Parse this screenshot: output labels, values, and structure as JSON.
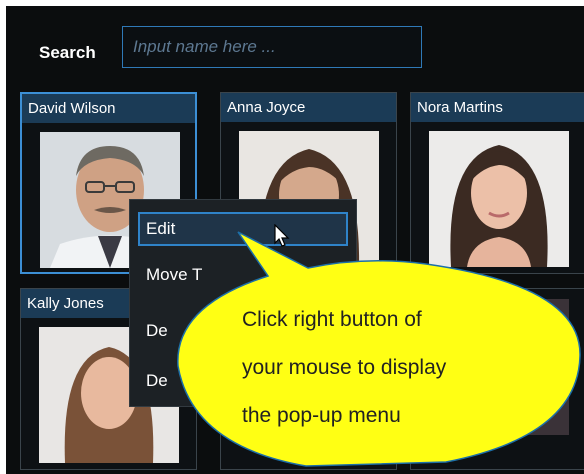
{
  "search": {
    "label": "Search",
    "placeholder": "Input name here ..."
  },
  "faces": [
    {
      "name": "David Wilson",
      "selected": true
    },
    {
      "name": "Anna Joyce",
      "selected": false
    },
    {
      "name": "Nora Martins",
      "selected": false
    },
    {
      "name": "Kally Jones",
      "selected": false
    }
  ],
  "context_menu": {
    "items": [
      {
        "label": "Edit",
        "active": true
      },
      {
        "label": "Move T"
      },
      {
        "label": "De"
      },
      {
        "label": "De"
      }
    ]
  },
  "callout": {
    "lines": [
      "Click right button of",
      "your mouse to display",
      "the pop-up menu"
    ],
    "fill_color": "#ffff14",
    "border_color": "#1c6fa8"
  },
  "colors": {
    "accent": "#3c8fd5",
    "name_bar": "#1b3b56",
    "background": "#0b0d0e"
  },
  "icons": {
    "cursor": "mouse-pointer-icon"
  }
}
